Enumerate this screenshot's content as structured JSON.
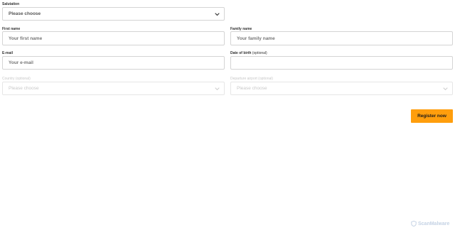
{
  "form": {
    "salutation": {
      "label": "Salutation",
      "value": "Please choose"
    },
    "first_name": {
      "label": "First name",
      "placeholder": "Your first name"
    },
    "family_name": {
      "label": "Family name",
      "placeholder": "Your family name"
    },
    "email": {
      "label": "E-mail",
      "placeholder": "Your e-mail"
    },
    "date_of_birth": {
      "label": "Date of birth",
      "optional": "(optional)"
    },
    "country": {
      "label": "Country (optional)",
      "value": "Please choose"
    },
    "interest": {
      "label": "Departure airport (optional)",
      "value": "Please choose"
    },
    "submit_label": "Register now"
  },
  "watermark": {
    "text": "ScanMalware",
    "icon": "shield-icon",
    "color": "#c4d2e4"
  },
  "colors": {
    "accent": "#ff9e0d",
    "border": "#d4d4d4"
  }
}
